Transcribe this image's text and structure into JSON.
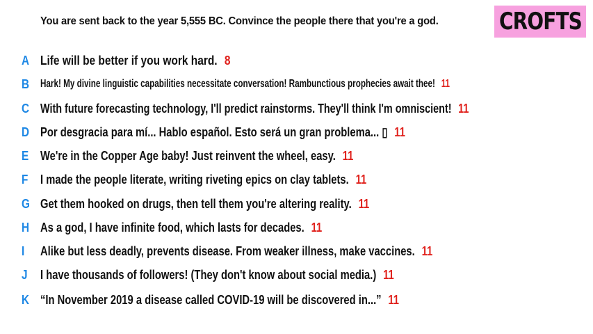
{
  "prompt": "You are sent back to the year 5,555 BC. Convince the people there that you're a god.",
  "logo": "CROFTS",
  "colors": {
    "letter": "#1e88e5",
    "score": "#e0211c",
    "logo_bg": "#f7a1df"
  },
  "answers": [
    {
      "letter": "A",
      "text": "Life will be better if you work hard.",
      "score": "8"
    },
    {
      "letter": "B",
      "text": "Hark! My divine linguistic capabilities necessitate conversation! Rambunctious prophecies await thee!",
      "score": "11"
    },
    {
      "letter": "C",
      "text": "With future forecasting technology, I'll predict rainstorms. They'll think I'm omniscient!",
      "score": "11"
    },
    {
      "letter": "D",
      "text": "Por desgracia para mí... Hablo español. Esto será un gran problema... ▯",
      "score": "11"
    },
    {
      "letter": "E",
      "text": "We're in the Copper Age baby! Just reinvent the wheel, easy.",
      "score": "11"
    },
    {
      "letter": "F",
      "text": "I made the people literate, writing riveting epics on clay tablets.",
      "score": "11"
    },
    {
      "letter": "G",
      "text": "Get them hooked on drugs, then tell them you're altering reality.",
      "score": "11"
    },
    {
      "letter": "H",
      "text": "As a god, I have infinite food, which lasts for decades.",
      "score": "11"
    },
    {
      "letter": "I",
      "text": "Alike but less deadly, prevents disease. From weaker illness, make vaccines.",
      "score": "11"
    },
    {
      "letter": "J",
      "text": "I have thousands of followers! (They don't know about social media.)",
      "score": "11"
    },
    {
      "letter": "K",
      "text": "“In November 2019 a disease called COVID-19 will be discovered in...”",
      "score": "11"
    }
  ]
}
